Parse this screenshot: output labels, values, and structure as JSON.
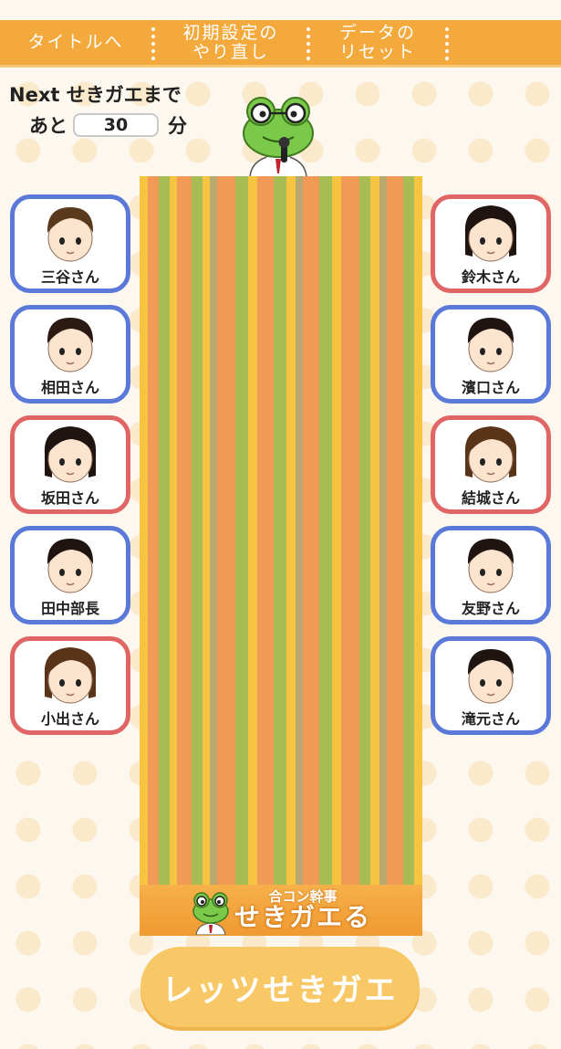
{
  "nav": {
    "title_btn": "タイトルへ",
    "reset_setup_line1": "初期設定の",
    "reset_setup_line2": "やり直し",
    "reset_data_line1": "データの",
    "reset_data_line2": "リセット"
  },
  "timer": {
    "prefix": "Next せきガエまで",
    "ato": "あと",
    "minutes": "30",
    "unit": "分"
  },
  "table": {
    "logo_sub": "合コン幹事",
    "logo_main": "せきガエる"
  },
  "left_seats": [
    {
      "name": "三谷さん",
      "gender": "male",
      "hair": "#5a3a1c"
    },
    {
      "name": "相田さん",
      "gender": "male",
      "hair": "#2a1a12"
    },
    {
      "name": "坂田さん",
      "gender": "female",
      "hair": "#1f1410"
    },
    {
      "name": "田中部長",
      "gender": "male",
      "hair": "#1f1410"
    },
    {
      "name": "小出さん",
      "gender": "female",
      "hair": "#5a3418"
    }
  ],
  "right_seats": [
    {
      "name": "鈴木さん",
      "gender": "female",
      "hair": "#1f1410"
    },
    {
      "name": "濱口さん",
      "gender": "male",
      "hair": "#1f1410"
    },
    {
      "name": "結城さん",
      "gender": "female",
      "hair": "#5a3418"
    },
    {
      "name": "友野さん",
      "gender": "male",
      "hair": "#1f1410"
    },
    {
      "name": "滝元さん",
      "gender": "male",
      "hair": "#1f1410"
    }
  ],
  "action": {
    "lets_btn": "レッツせきガエ"
  },
  "colors": {
    "male_border": "#5b79d8",
    "female_border": "#e06565",
    "bar": "#f3a93c"
  }
}
